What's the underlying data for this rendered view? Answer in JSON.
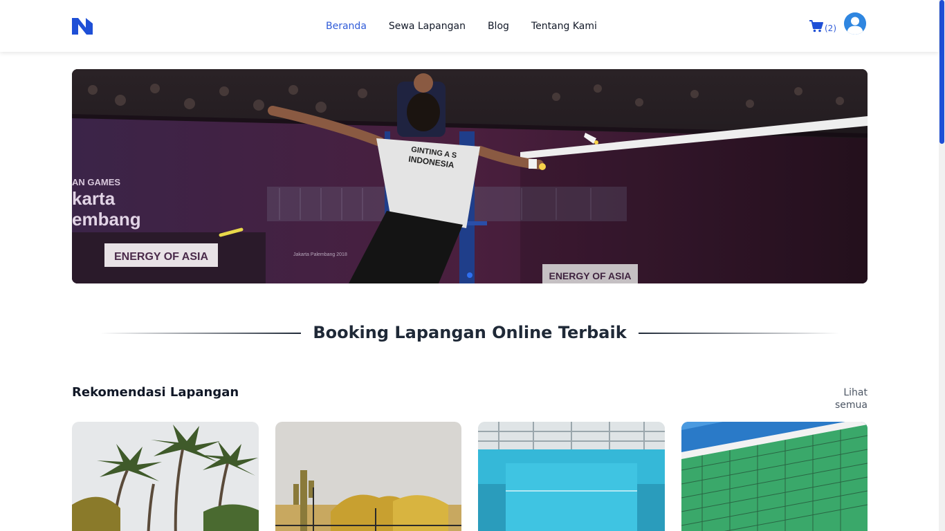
{
  "header": {
    "logo": "N",
    "nav": [
      {
        "label": "Beranda",
        "active": true
      },
      {
        "label": "Sewa Lapangan",
        "active": false
      },
      {
        "label": "Blog",
        "active": false
      },
      {
        "label": "Tentang Kami",
        "active": false
      }
    ],
    "cart_count": "(2)",
    "cart_icon": "cart-icon",
    "avatar_icon": "user-avatar-icon"
  },
  "hero": {
    "image_text": {
      "jersey_line1": "GINTING A S",
      "jersey_line2": "INDONESIA",
      "banner_line1": "AN GAMES",
      "banner_line2": "karta",
      "banner_line3": "embang",
      "board_left": "ENERGY OF ASIA",
      "board_right": "ENERGY OF ASIA",
      "small_text": "Jakarta Palembang 2018"
    }
  },
  "section": {
    "title": "Booking Lapangan Online Terbaik"
  },
  "recommendations": {
    "title": "Rekomendasi Lapangan",
    "see_all": "Lihat semua",
    "cards": [
      {
        "image": "palm-trees-court"
      },
      {
        "image": "desert-cactus-court"
      },
      {
        "image": "indoor-blue-court"
      },
      {
        "image": "green-net-court"
      }
    ]
  },
  "colors": {
    "accent": "#2f5bd8",
    "heading": "#1f2937",
    "scroll_thumb": "#1e4fd6"
  }
}
